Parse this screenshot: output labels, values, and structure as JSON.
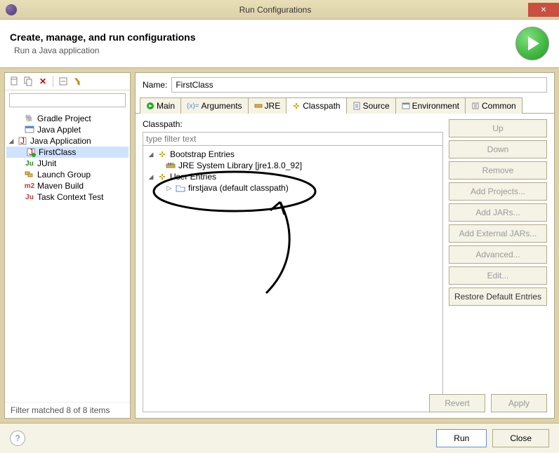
{
  "window": {
    "title": "Run Configurations"
  },
  "header": {
    "title": "Create, manage, and run configurations",
    "subtitle": "Run a Java application"
  },
  "left": {
    "filter_value": "",
    "items": [
      {
        "icon": "gradle",
        "label": "Gradle Project"
      },
      {
        "icon": "applet",
        "label": "Java Applet"
      },
      {
        "icon": "java",
        "label": "Java Application",
        "expanded": true
      },
      {
        "icon": "java-run",
        "label": "FirstClass",
        "child": true,
        "selected": true
      },
      {
        "icon": "junit",
        "label": "JUnit"
      },
      {
        "icon": "launch",
        "label": "Launch Group"
      },
      {
        "icon": "maven",
        "label": "Maven Build"
      },
      {
        "icon": "task",
        "label": "Task Context Test"
      }
    ],
    "status": "Filter matched 8 of 8 items"
  },
  "detail": {
    "name_label": "Name:",
    "name_value": "FirstClass",
    "tabs": [
      {
        "id": "main",
        "label": "Main"
      },
      {
        "id": "arguments",
        "label": "Arguments"
      },
      {
        "id": "jre",
        "label": "JRE"
      },
      {
        "id": "classpath",
        "label": "Classpath",
        "active": true
      },
      {
        "id": "source",
        "label": "Source"
      },
      {
        "id": "environment",
        "label": "Environment"
      },
      {
        "id": "common",
        "label": "Common"
      }
    ],
    "classpath": {
      "heading": "Classpath:",
      "filter_placeholder": "type filter text",
      "tree": {
        "bootstrap_label": "Bootstrap Entries",
        "jre_label": "JRE System Library [jre1.8.0_92]",
        "user_label": "User Entries",
        "project_label": "firstjava (default classpath)"
      },
      "buttons": {
        "up": "Up",
        "down": "Down",
        "remove": "Remove",
        "add_projects": "Add Projects...",
        "add_jars": "Add JARs...",
        "add_ext": "Add External JARs...",
        "advanced": "Advanced...",
        "edit": "Edit...",
        "restore": "Restore Default Entries"
      }
    },
    "revert": "Revert",
    "apply": "Apply"
  },
  "footer": {
    "run": "Run",
    "close": "Close"
  }
}
